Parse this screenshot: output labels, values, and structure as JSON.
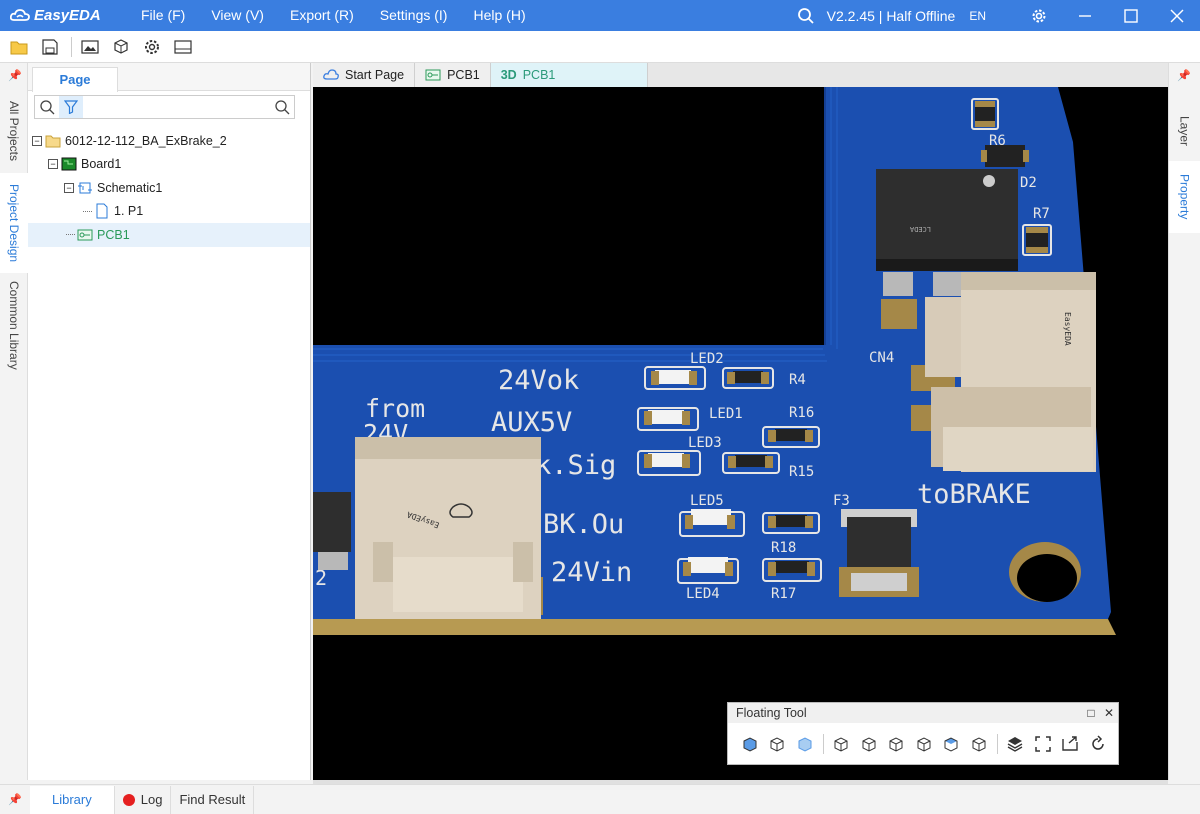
{
  "app": {
    "name": "EasyEDA",
    "version": "V2.2.45 | Half Offline",
    "language": "EN"
  },
  "menu": [
    "File (F)",
    "View (V)",
    "Export (R)",
    "Settings (I)",
    "Help (H)"
  ],
  "left_strip_tabs": [
    "All Projects",
    "Project Design",
    "Common Library"
  ],
  "left_panel": {
    "tab": "Page",
    "search_placeholder": "",
    "tree": [
      {
        "label": "6012-12-112_BA_ExBrake_2",
        "icon": "folder-icon"
      },
      {
        "label": "Board1",
        "icon": "board-icon"
      },
      {
        "label": "Schematic1",
        "icon": "schematic-icon"
      },
      {
        "label": "1. P1",
        "icon": "page-icon"
      },
      {
        "label": "PCB1",
        "icon": "pcb-icon",
        "selected": true
      }
    ]
  },
  "doc_tabs": [
    {
      "label": "Start Page"
    },
    {
      "label": "PCB1"
    },
    {
      "label": "PCB1",
      "prefix": "3D",
      "active": true
    }
  ],
  "right_strip_tabs": [
    "Layer",
    "Property"
  ],
  "pcb_labels": {
    "r6": "R6",
    "d2": "D2",
    "r7": "R7",
    "cn4": "CN4",
    "led2": "LED2",
    "r4": "R4",
    "led1": "LED1",
    "r16": "R16",
    "led3": "LED3",
    "r15": "R15",
    "led5": "LED5",
    "f3": "F3",
    "r18": "R18",
    "r17": "R17",
    "led4": "LED4",
    "v24ok": "24Vok",
    "aux5v": "AUX5V",
    "sig": "k.Sig",
    "bkou": "BK.Ou",
    "v24in": "24Vin",
    "from": "from",
    "v24": "24V",
    "tobrake": "toBRAKE",
    "two": "2",
    "lceda": "LCEDA",
    "easyeda": "EasyEDA"
  },
  "floating_tool": {
    "title": "Floating Tool"
  },
  "bottom_tabs": [
    "Library",
    "Log",
    "Find Result"
  ],
  "colors": {
    "accent": "#3a7ee0",
    "pcb_blue": "#1b4fb0",
    "pad": "#a58848"
  }
}
